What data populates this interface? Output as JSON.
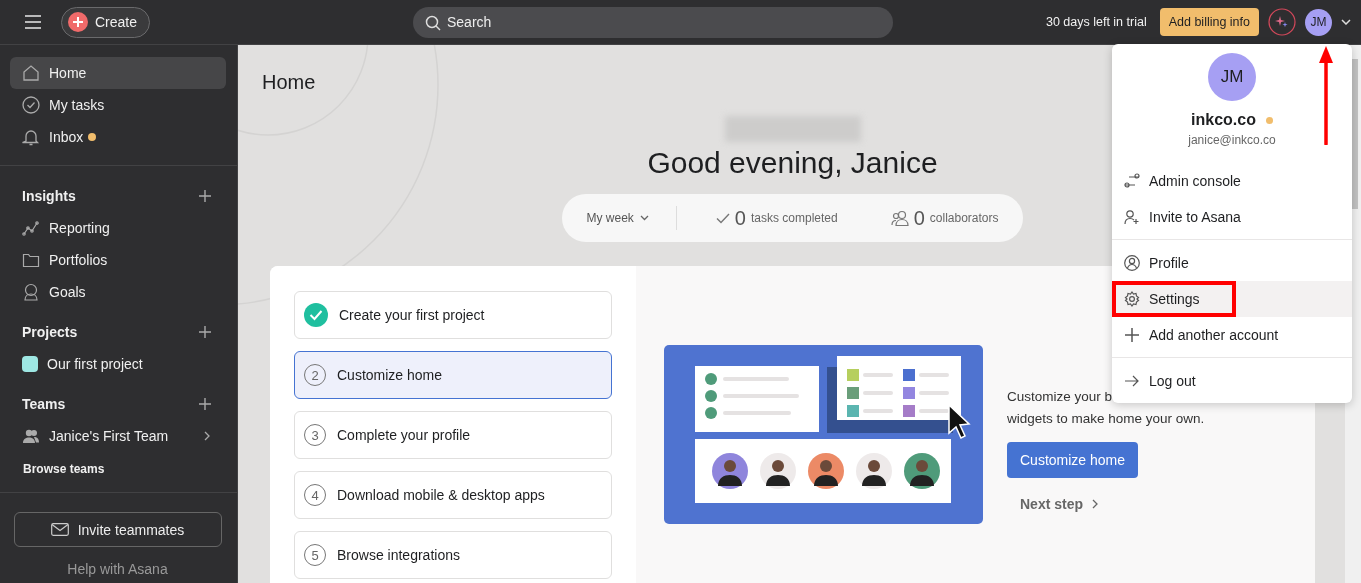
{
  "topbar": {
    "create": "Create",
    "search": {
      "placeholder": "Search"
    },
    "trial": "30 days left in trial",
    "billing": "Add billing info",
    "avatar": "JM"
  },
  "sidebar": {
    "nav": [
      {
        "label": "Home",
        "selected": true,
        "unread": false
      },
      {
        "label": "My tasks",
        "selected": false,
        "unread": false
      },
      {
        "label": "Inbox",
        "selected": false,
        "unread": true
      }
    ],
    "sections": [
      {
        "title": "Insights",
        "items": [
          {
            "label": "Reporting"
          },
          {
            "label": "Portfolios"
          },
          {
            "label": "Goals"
          }
        ]
      },
      {
        "title": "Projects",
        "items": [
          {
            "label": "Our first project",
            "color": "#9ee7e3"
          }
        ]
      },
      {
        "title": "Teams",
        "items": [
          {
            "label": "Janice's First Team"
          }
        ]
      }
    ],
    "browse": "Browse teams",
    "invite": "Invite teammates",
    "help": "Help with Asana"
  },
  "main": {
    "title": "Home",
    "greeting": "Good evening, Janice",
    "stats": {
      "period": "My week",
      "tasks_count": "0",
      "tasks_label": "tasks completed",
      "collab_count": "0",
      "collab_label": "collaborators"
    },
    "steps": [
      {
        "label": "Create your first project",
        "done": true,
        "selected": false
      },
      {
        "number": "2",
        "label": "Customize home",
        "done": false,
        "selected": true
      },
      {
        "number": "3",
        "label": "Complete your profile",
        "done": false,
        "selected": false
      },
      {
        "number": "4",
        "label": "Download mobile & desktop apps",
        "done": false,
        "selected": false
      },
      {
        "number": "5",
        "label": "Browse integrations",
        "done": false,
        "selected": false
      }
    ],
    "description": [
      "Customize your b",
      "widgets to make home your own."
    ],
    "action": "Customize home",
    "next": "Next step"
  },
  "menu": {
    "avatar": "JM",
    "workspace": "inkco.co",
    "email": "janice@inkco.co",
    "groups": [
      [
        {
          "label": "Admin console",
          "highlighted": false,
          "outlined": false
        },
        {
          "label": "Invite to Asana",
          "highlighted": false,
          "outlined": false
        }
      ],
      [
        {
          "label": "Profile",
          "highlighted": false,
          "outlined": false
        },
        {
          "label": "Settings",
          "highlighted": true,
          "outlined": true
        },
        {
          "label": "Add another account",
          "highlighted": false,
          "outlined": false
        }
      ],
      [
        {
          "label": "Log out",
          "highlighted": false,
          "outlined": false
        }
      ]
    ]
  }
}
